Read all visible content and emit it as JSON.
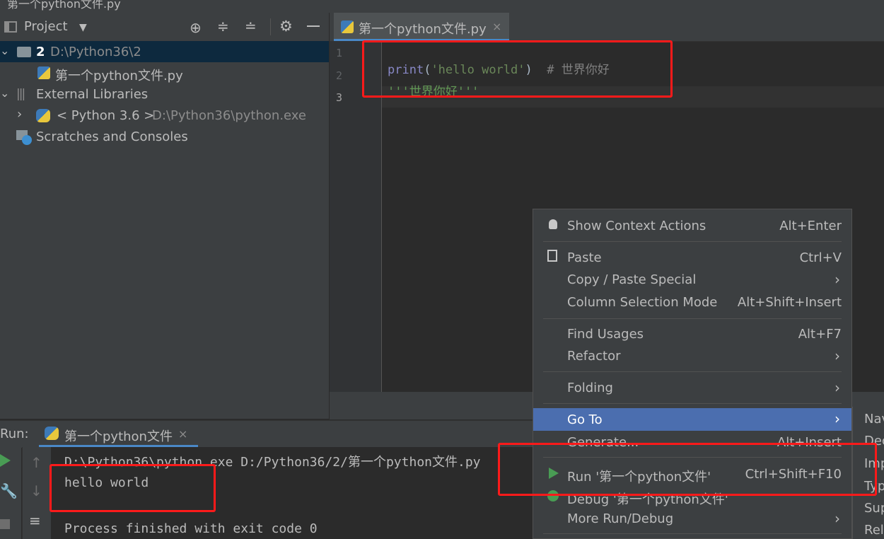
{
  "window": {
    "title": "第一个python文件.py"
  },
  "project_panel": {
    "title": "Project",
    "tree": [
      {
        "label": "2",
        "path": "D:\\Python36\\2"
      },
      {
        "label": "第一个python文件.py"
      },
      {
        "label": "External Libraries"
      },
      {
        "label": "< Python 3.6 >",
        "path": "D:\\Python36\\python.exe"
      },
      {
        "label": "Scratches and Consoles"
      }
    ]
  },
  "editor": {
    "tab": {
      "label": "第一个python文件.py"
    },
    "line_numbers": [
      "1",
      "2",
      "3"
    ],
    "lines": {
      "l1_func": "print",
      "l1_open": "(",
      "l1_str": "'hello world'",
      "l1_close": ")",
      "l1_comment": "  # 世界你好",
      "l2_doc": "'''世界你好'''"
    }
  },
  "run_panel": {
    "label": "Run:",
    "tab_label": "第一个python文件",
    "console": [
      "D:\\Python36\\python.exe D:/Python36/2/第一个python文件.py",
      "hello world",
      "",
      "Process finished with exit code 0"
    ]
  },
  "context_menu": {
    "items": [
      {
        "label": "Show Context Actions",
        "shortcut": "Alt+Enter"
      },
      {
        "label": "Paste",
        "shortcut": "Ctrl+V"
      },
      {
        "label": "Copy / Paste Special",
        "shortcut": "›"
      },
      {
        "label": "Column Selection Mode",
        "shortcut": "Alt+Shift+Insert"
      },
      {
        "label": "Find Usages",
        "shortcut": "Alt+F7"
      },
      {
        "label": "Refactor",
        "shortcut": "›"
      },
      {
        "label": "Folding",
        "shortcut": "›"
      },
      {
        "label": "Go To",
        "shortcut": "›"
      },
      {
        "label": "Generate...",
        "shortcut": "Alt+Insert"
      },
      {
        "label": "Run '第一个python文件'",
        "shortcut": "Ctrl+Shift+F10"
      },
      {
        "label": "Debug '第一个python文件'",
        "shortcut": ""
      },
      {
        "label": "More Run/Debug",
        "shortcut": "›"
      }
    ],
    "submenu": [
      "Nav",
      "Dec",
      "Imp",
      "Typ",
      "Sup",
      "Rel"
    ]
  },
  "colors": {
    "highlight": "#4b6eaf",
    "annotation": "#ff1a1a",
    "keyword": "#8888c6",
    "string": "#6a8759",
    "comment": "#808080"
  }
}
